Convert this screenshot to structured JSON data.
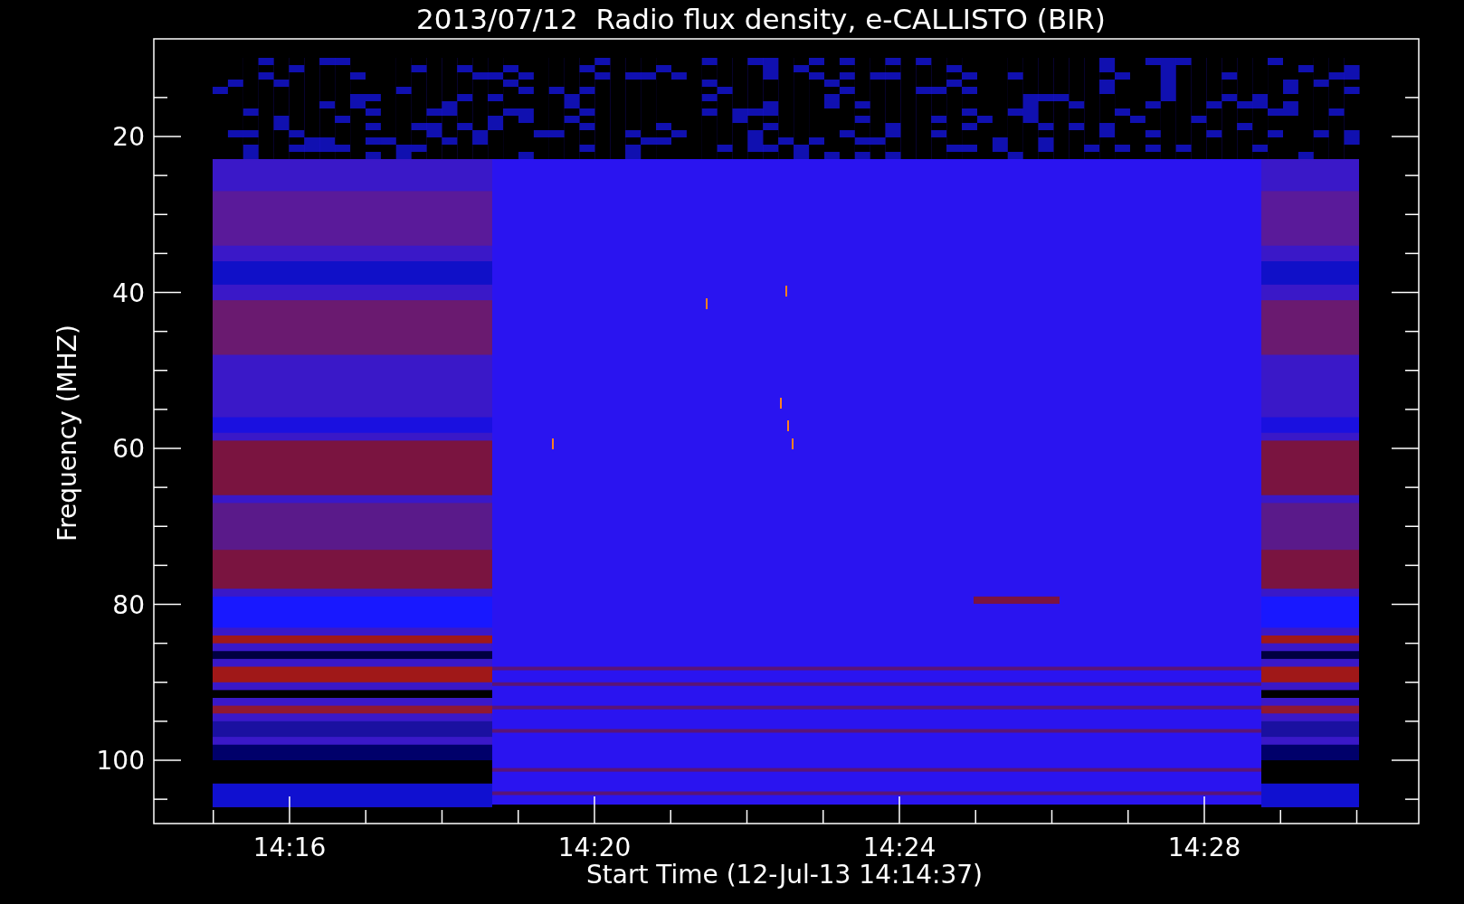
{
  "title": "2013/07/12  Radio flux density, e-CALLISTO (BIR)",
  "y_axis": {
    "label": "Frequency (MHZ)",
    "tick_labels": [
      "20",
      "40",
      "60",
      "80",
      "100"
    ]
  },
  "x_axis": {
    "label": "Start Time (12-Jul-13 14:14:37)",
    "tick_labels": [
      "14:16",
      "14:20",
      "14:24",
      "14:28"
    ]
  }
}
